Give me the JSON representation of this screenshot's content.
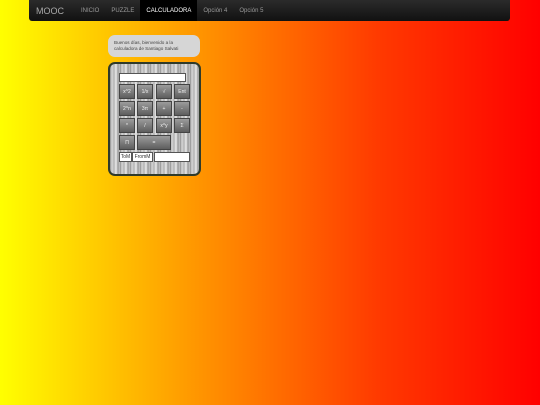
{
  "navbar": {
    "brand": "MOOC",
    "links": [
      "INICIO",
      "PUZZLE",
      "CALCULADORA",
      "Opción 4",
      "Opción 5"
    ],
    "active_index": 2
  },
  "bubble": {
    "text": "Buenos días, bienvenido a la calculadora de Santiago Salvati"
  },
  "calculator": {
    "display_value": "",
    "rows": [
      [
        "x^2",
        "1/x",
        "√",
        "Ent"
      ],
      [
        "2^n",
        "3π",
        "+",
        "-"
      ],
      [
        "*",
        "/",
        "x^y",
        "Σ"
      ],
      [
        "Π",
        "="
      ]
    ],
    "to_memory_label": "ToM",
    "from_memory_label": "FromM",
    "memory_value": ""
  },
  "colors": {
    "gradient_start": "#ffff00",
    "gradient_end": "#ff0000",
    "navbar": "#1b1b1b"
  }
}
